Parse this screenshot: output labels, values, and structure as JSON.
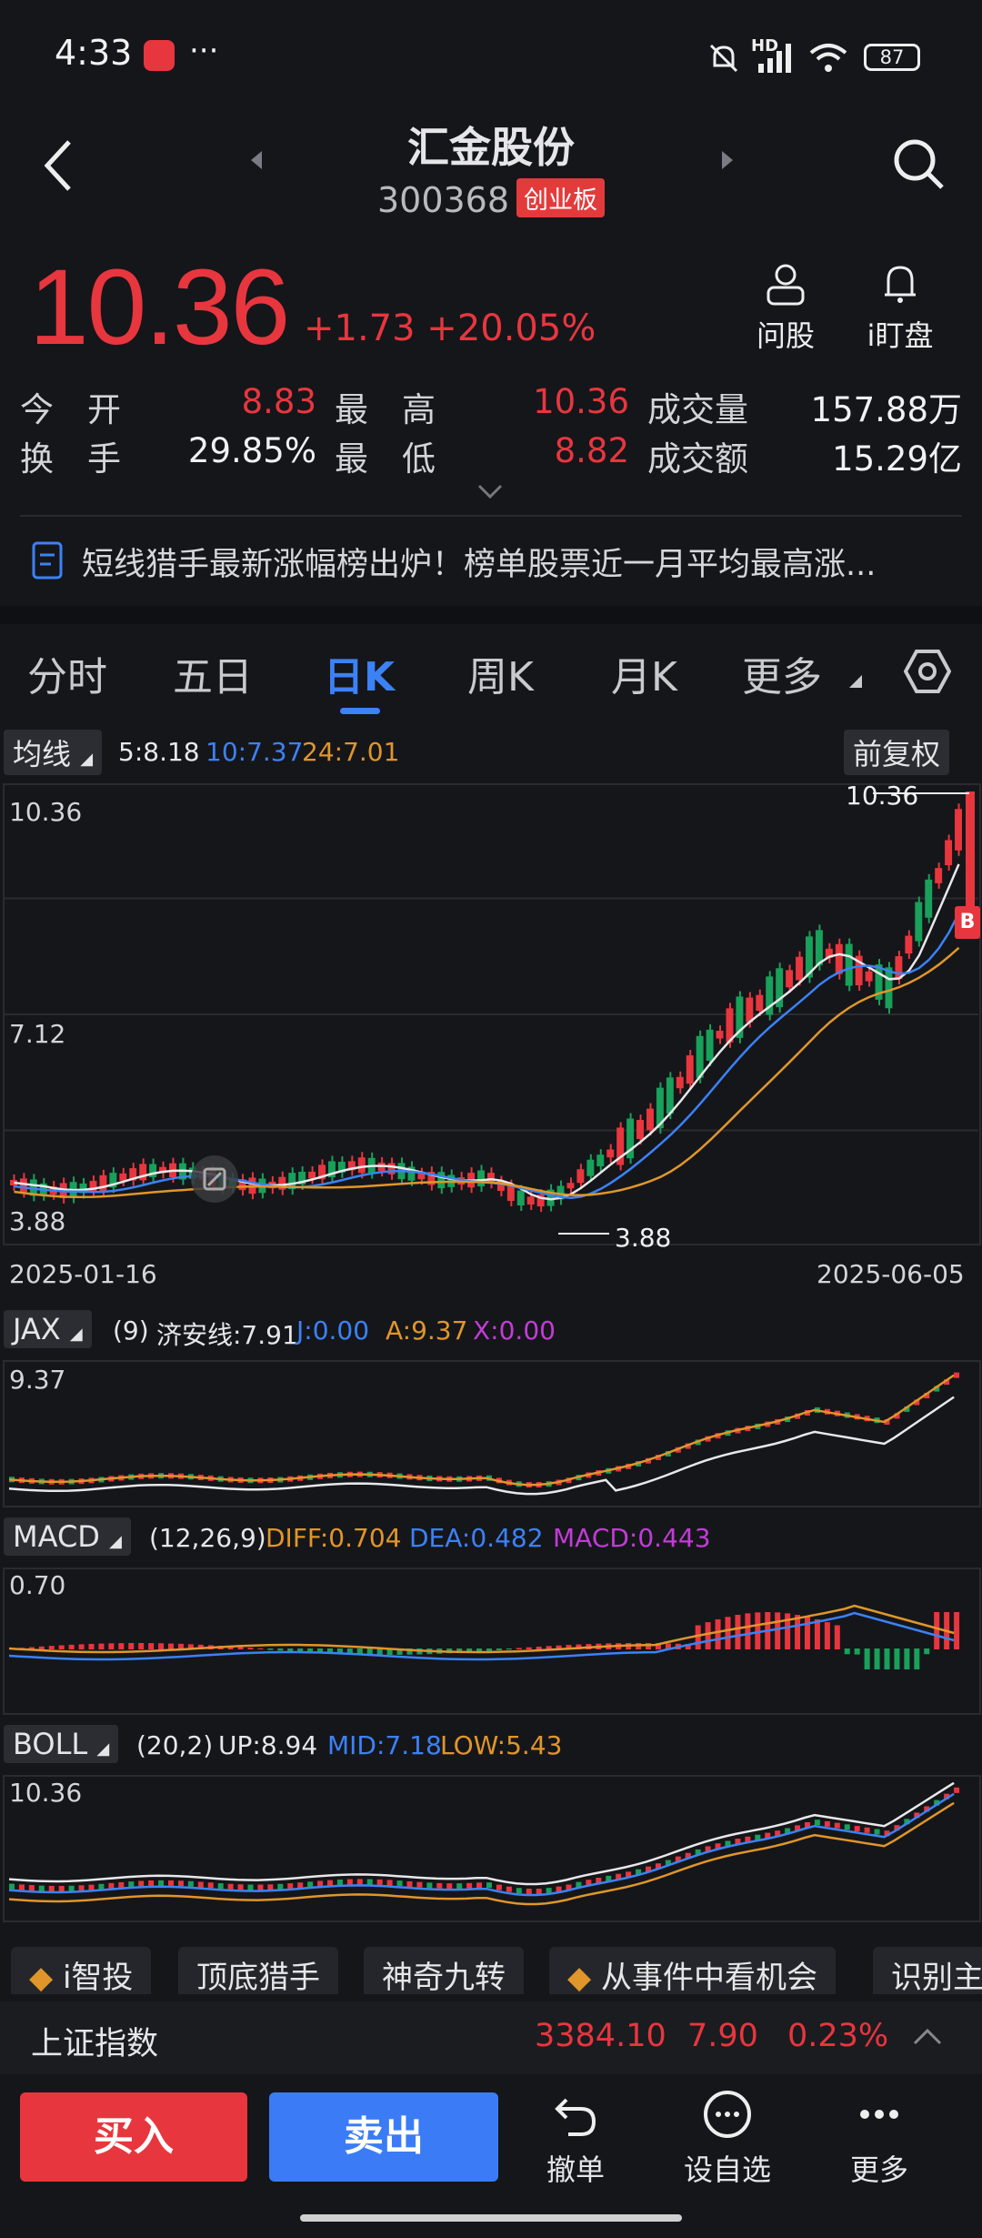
{
  "status": {
    "time": "4:33",
    "network": "HD",
    "battery": "87"
  },
  "header": {
    "title": "汇金股份",
    "code": "300368",
    "board": "创业板"
  },
  "quote": {
    "price": "10.36",
    "change": "+1.73",
    "change_pct": "+20.05%",
    "actions": [
      {
        "label": "问股",
        "icon": "person-icon"
      },
      {
        "label": "i盯盘",
        "icon": "bell-icon"
      }
    ],
    "rows": [
      {
        "l1": "今　开",
        "v1": "8.83",
        "l2": "最　高",
        "v2": "10.36",
        "l3": "成交量",
        "v3": "157.88万"
      },
      {
        "l1": "换　手",
        "v1": "29.85%",
        "l2": "最　低",
        "v2": "8.82",
        "l3": "成交额",
        "v3": "15.29亿"
      }
    ]
  },
  "news": "短线猎手最新涨幅榜出炉！榜单股票近一月平均最高涨...",
  "tabs": [
    "分时",
    "五日",
    "日K",
    "周K",
    "月K",
    "更多"
  ],
  "active_tab": "日K",
  "kline": {
    "ma_label": "均线",
    "ma5": "5:8.18",
    "ma10": "10:7.37",
    "ma24": "24:7.01",
    "adjust": "前复权",
    "y_top": "10.36",
    "y_mid": "7.12",
    "y_bottom": "3.88",
    "max_label": "10.36",
    "min_label": "3.88",
    "date_start": "2025-01-16",
    "date_end": "2025-06-05",
    "marker": "B"
  },
  "jax": {
    "name": "JAX",
    "param": "(9)",
    "line": "济安线:7.91",
    "j": "J:0.00",
    "a": "A:9.37",
    "x": "X:0.00",
    "y_top": "9.37"
  },
  "macd": {
    "name": "MACD",
    "param": "(12,26,9)",
    "diff": "DIFF:0.704",
    "dea": "DEA:0.482",
    "macd": "MACD:0.443",
    "y_top": "0.70"
  },
  "boll": {
    "name": "BOLL",
    "param": "(20,2)",
    "up": "UP:8.94",
    "mid": "MID:7.18",
    "low": "LOW:5.43",
    "y_top": "10.36"
  },
  "tools": [
    "i智投",
    "顶底猎手",
    "神奇九转",
    "从事件中看机会",
    "识别主"
  ],
  "index": {
    "name": "上证指数",
    "value": "3384.10",
    "change": "7.90",
    "pct": "0.23%"
  },
  "bottom": {
    "buy": "买入",
    "sell": "卖出",
    "actions": [
      "撤单",
      "设自选",
      "更多"
    ]
  },
  "colors": {
    "up": "#e8363e",
    "down": "#19a05a",
    "blue": "#3b82f6",
    "orange": "#e0962a",
    "purple": "#c23cd6",
    "bg": "#15161a"
  }
}
